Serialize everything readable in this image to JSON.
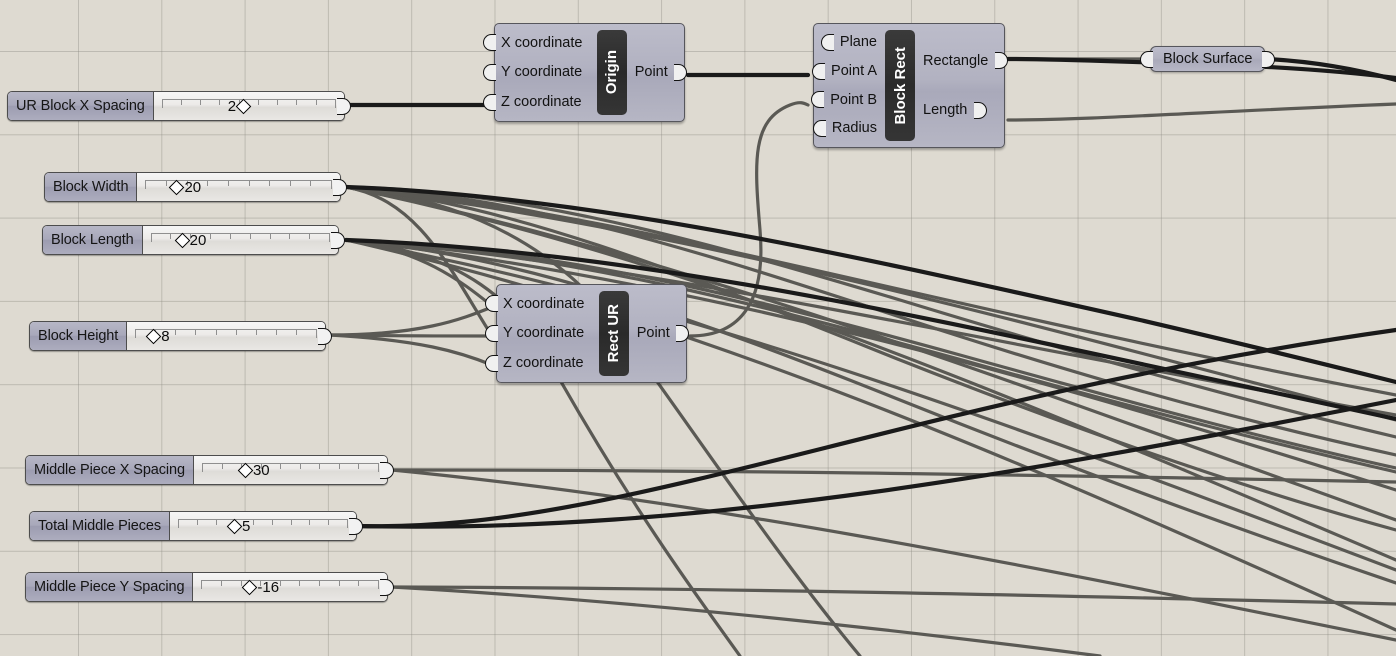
{
  "canvas": {
    "background_color": "#dedad1",
    "grid_color": "#8c8a82",
    "wire_color_thin": "#5a5954",
    "wire_color_thick": "#151515"
  },
  "sliders": [
    {
      "id": "ur-block-x-spacing",
      "name": "UR Block X Spacing",
      "value": "2",
      "handle_side": "right"
    },
    {
      "id": "block-width",
      "name": "Block Width",
      "value": "20",
      "handle_side": "left"
    },
    {
      "id": "block-length",
      "name": "Block Length",
      "value": "20",
      "handle_side": "left"
    },
    {
      "id": "block-height",
      "name": "Block Height",
      "value": "8",
      "handle_side": "left"
    },
    {
      "id": "middle-piece-x-spacing",
      "name": "Middle Piece X Spacing",
      "value": "30",
      "handle_side": "left"
    },
    {
      "id": "total-middle-pieces",
      "name": "Total Middle Pieces",
      "value": "5",
      "handle_side": "left"
    },
    {
      "id": "middle-piece-y-spacing",
      "name": "Middle Piece Y Spacing",
      "value": "-16",
      "handle_side": "left"
    }
  ],
  "nodes": [
    {
      "id": "origin",
      "title": "Origin",
      "inputs": [
        "X coordinate",
        "Y coordinate",
        "Z coordinate"
      ],
      "outputs": [
        "Point"
      ]
    },
    {
      "id": "block-rect",
      "title": "Block Rect",
      "inputs": [
        "Plane",
        "Point A",
        "Point B",
        "Radius"
      ],
      "outputs": [
        "Rectangle",
        "Length"
      ]
    },
    {
      "id": "rect-ur",
      "title": "Rect UR",
      "inputs": [
        "X coordinate",
        "Y coordinate",
        "Z coordinate"
      ],
      "outputs": [
        "Point"
      ]
    }
  ],
  "pills": [
    {
      "id": "block-surface",
      "label": "Block Surface"
    }
  ]
}
